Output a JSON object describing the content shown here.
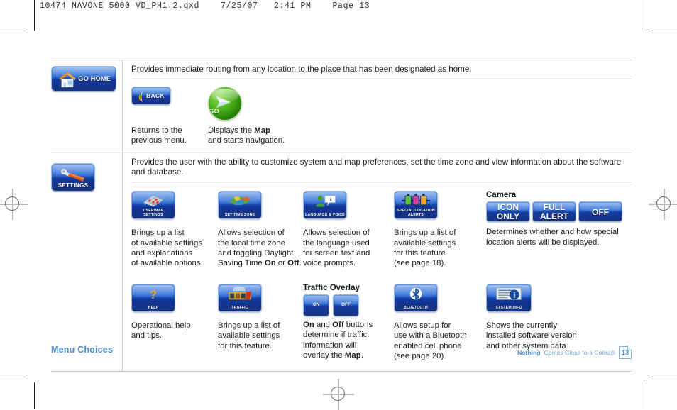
{
  "prepress": {
    "header": "10474 NAVONE 5000 VD_PH1.2.qxd    7/25/07   2:41 PM    Page 13"
  },
  "rows": [
    {
      "icon_label": "GO HOME",
      "icon_name": "go-home-button",
      "description": "Provides immediate routing from any location to the place that has been designated as home.",
      "items": [
        {
          "kind": "back",
          "label": "BACK",
          "caption_parts": [
            {
              "text": "Returns to the",
              "bold": false
            },
            {
              "text": "previous menu.",
              "bold": false
            }
          ]
        },
        {
          "kind": "go",
          "label": "GO",
          "caption_parts": [
            {
              "text": "Displays the ",
              "bold": false
            },
            {
              "text": "Map",
              "bold": true
            },
            {
              "text": "and starts navigation.",
              "bold": false
            }
          ]
        }
      ]
    },
    {
      "icon_label": "SETTINGS",
      "icon_name": "settings-button",
      "description": "Provides the user with the ability to customize system and map preferences, set the time zone and view information about the software and database."
    }
  ],
  "settings_grid": {
    "row1": [
      {
        "tile_label": "USER/MAP\nSETTINGS",
        "name": "user-map-settings-tile",
        "caption": "Brings up a list\nof available settings\nand explanations\nof available options."
      },
      {
        "tile_label": "SET TIME ZONE",
        "name": "set-time-zone-tile",
        "caption_html": "Allows selection of|the local time zone|and toggling Daylight|Saving Time <b>On</b> or <b>Off</b>."
      },
      {
        "tile_label": "LANGUAGE & VOICE",
        "name": "language-and-voice-tile",
        "caption": "Allows selection of\nthe language used\nfor screen text and\nvoice prompts."
      },
      {
        "tile_label": "SPECIAL LOCATION\nALERTS",
        "name": "special-location-alerts-tile",
        "caption": "Brings up a list of\navailable settings\nfor this feature\n(see page 18)."
      }
    ],
    "camera": {
      "title": "Camera",
      "name": "camera-option-group",
      "buttons": [
        {
          "label": "ICON\nONLY",
          "name": "camera-icon-only-button"
        },
        {
          "label": "FULL\nALERT",
          "name": "camera-full-alert-button"
        },
        {
          "label": "OFF",
          "name": "camera-off-button"
        }
      ],
      "caption": "Determines whether and how special\nlocation alerts will be displayed."
    },
    "row2": [
      {
        "tile_label": "HELP",
        "name": "help-tile",
        "caption": "Operational help\nand tips."
      },
      {
        "tile_label": "TRAFFIC",
        "name": "traffic-tile",
        "caption": "Brings up a list of\navailable settings\nfor this feature."
      }
    ],
    "traffic_overlay": {
      "title": "Traffic Overlay",
      "name": "traffic-overlay-option-group",
      "buttons": [
        {
          "label": "ON",
          "name": "traffic-on-button"
        },
        {
          "label": "OFF",
          "name": "traffic-off-button"
        }
      ],
      "caption_html": "<b>On</b> and <b>Off</b> buttons|determine if traffic|information will|overlay the <b>Map</b>."
    },
    "row2b": [
      {
        "tile_label": "BLUETOOTH",
        "name": "bluetooth-tile",
        "caption": "Allows setup for\nuse with a Bluetooth\nenabled cell phone\n(see page 20)."
      },
      {
        "tile_label": "SYSTEM INFO",
        "name": "system-info-tile",
        "caption": "Shows the currently\ninstalled software version\nand other system data."
      }
    ]
  },
  "footer": {
    "section": "Menu Choices",
    "tagline_bold": "Nothing",
    "tagline_rest": "Comes Close to a Cobra®",
    "page_number": "13"
  },
  "colors": {
    "button_blue_light": "#5f95e8",
    "button_blue_dark": "#16327f",
    "go_green": "#52b820",
    "footer_blue": "#4a8fd4",
    "rule_gray": "#c8c8c8"
  }
}
